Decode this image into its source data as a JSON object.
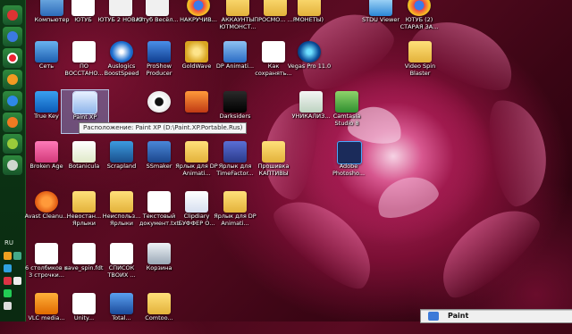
{
  "tooltip": "Расположение: Paint XP (D:\\Paint.XP.Portable.Rus)",
  "popup": {
    "title": "Paint"
  },
  "sidebar": {
    "lang": "RU"
  },
  "icons": {
    "komputer": "Компьютер",
    "youtube": "ЮТУБ",
    "youtube2_new": "ЮТУБ 2 НОВАЯ",
    "youtube_fun": "Ютуб Весёл...",
    "nakruchiv": "НАКРУЧИВ...",
    "accounts": "АККАУНТЫ ЮТМОНСТ...",
    "prosmotr": "ПРОСМО... ...Р",
    "monety": "МОНЕТЫ)",
    "stdu": "STDU Viewer",
    "youtube2_old": "ЮТУБ (2) СТАРАЯ ЗА...",
    "set": "Сеть",
    "po_vosstan": "ПО ВОССТАНО...",
    "auslogics": "Auslogics BoostSpeed",
    "proshow": "ProShow Producer",
    "goldwave": "GoldWave",
    "dp_anim1": "DP Animati...",
    "kak_sohran": "Как сохранять...",
    "vegas": "Vegas Pro 11.0",
    "video_spin": "Video Spin Blaster",
    "truekey": "True Key",
    "paint_xp": "Paint XP",
    "darksiders": "Darksiders",
    "unikaliz": "УНИКАЛИЗ...",
    "camtasia": "Camtasia Studio 8",
    "broken_age": "Broken Age",
    "botanicula": "Botanicula",
    "scrapland": "Scrapland",
    "ssmaker": "SSmaker",
    "yarlyk_dp": "Ярлык для DP Animati...",
    "yarlyk_time": "Ярлык для TimeFactor...",
    "proshivka": "Прошивка КАПТИВЫ",
    "photoshop": "Adobe Photosho...",
    "avast": "Avast Cleanu...",
    "nevostan": "Невостан... Ярлыки",
    "neispolz": "Неиспольз... Ярлыки",
    "text_doc": "Текстовый документ.txt",
    "clipdiary": "Clipdiary БУФФЕР О...",
    "yarlyk_dp2": "Ярлык для DP Animati...",
    "stolb": "6 столбиков и 3 строчки...",
    "save_spin": "save_spin.fdt",
    "spisok": "СПИСОК ТВОИХ ...",
    "korzina": "Корзина",
    "vlc": "VLC media...",
    "unity": "Unity...",
    "total": "Total...",
    "comtoo": "Comtoo..."
  }
}
